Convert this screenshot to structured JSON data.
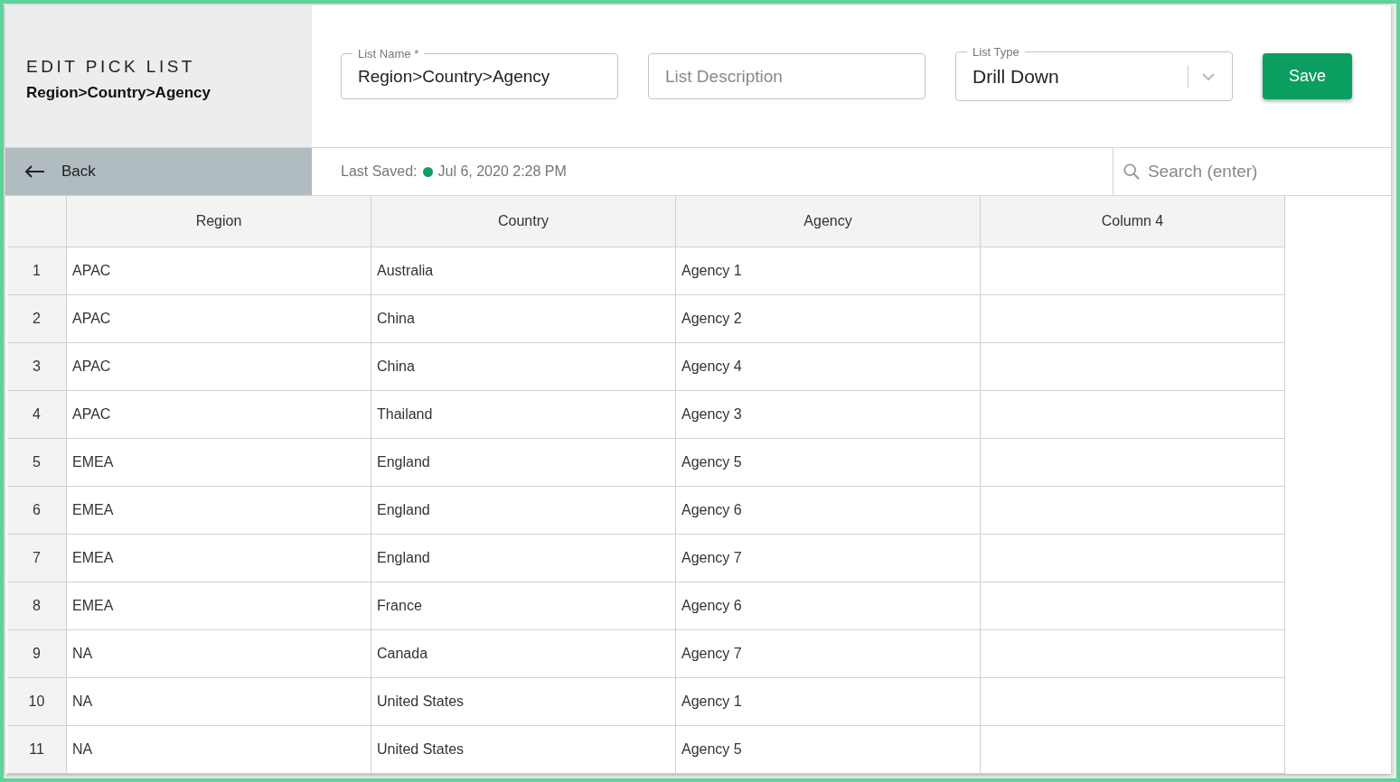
{
  "header": {
    "heading": "EDIT PICK LIST",
    "subheading": "Region>Country>Agency"
  },
  "fields": [
    {
      "kind": "text",
      "label": "List Name *",
      "value": "Region>Country>Agency"
    },
    {
      "kind": "text",
      "placeholder": "List Description"
    },
    {
      "kind": "select",
      "label": "List Type",
      "value": "Drill Down"
    }
  ],
  "save_button": "Save",
  "back_button": "Back",
  "last_saved": {
    "label": "Last Saved:",
    "color": "#0f9d63",
    "time": "Jul 6, 2020 2:28 PM"
  },
  "search": {
    "placeholder": "Search (enter)"
  },
  "table": {
    "columns": [
      "Region",
      "Country",
      "Agency",
      "Column 4"
    ],
    "rows": [
      {
        "number": "1",
        "cells": [
          "APAC",
          "Australia",
          "Agency 1"
        ]
      },
      {
        "number": "2",
        "cells": [
          "APAC",
          "China",
          "Agency 2"
        ]
      },
      {
        "number": "3",
        "cells": [
          "APAC",
          "China",
          "Agency 4"
        ]
      },
      {
        "number": "4",
        "cells": [
          "APAC",
          "Thailand",
          "Agency 3"
        ]
      },
      {
        "number": "5",
        "cells": [
          "EMEA",
          "England",
          "Agency 5"
        ]
      },
      {
        "number": "6",
        "cells": [
          "EMEA",
          "England",
          "Agency 6"
        ]
      },
      {
        "number": "7",
        "cells": [
          "EMEA",
          "England",
          "Agency 7"
        ]
      },
      {
        "number": "8",
        "cells": [
          "EMEA",
          "France",
          "Agency 6"
        ]
      },
      {
        "number": "9",
        "cells": [
          "NA",
          "Canada",
          "Agency 7"
        ]
      },
      {
        "number": "10",
        "cells": [
          "NA",
          "United States",
          "Agency 1"
        ]
      },
      {
        "number": "11",
        "cells": [
          "NA",
          "United States",
          "Agency 5"
        ]
      }
    ]
  }
}
